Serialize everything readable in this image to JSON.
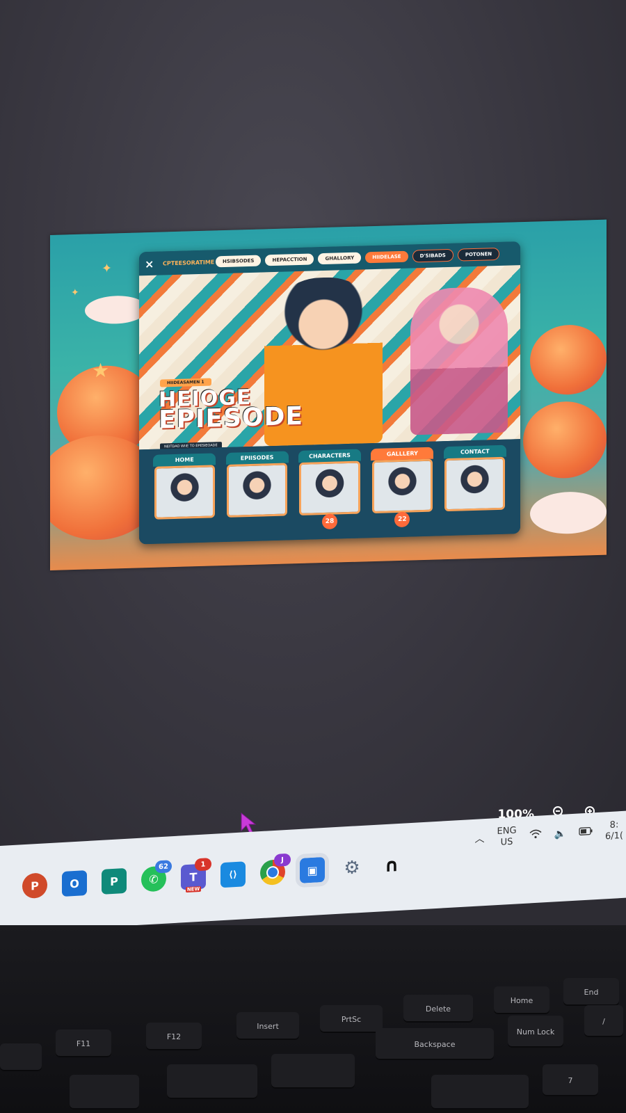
{
  "website": {
    "nav": {
      "close_icon": "×",
      "brand": "CPTEESORATIME",
      "items": [
        "HSIBSODES",
        "HEPACCTION",
        "GHALLORY"
      ],
      "right_items": [
        "HIIDELASE",
        "D'SIBADS",
        "POTONEN"
      ]
    },
    "hero": {
      "badge": "HIIDEASAMEN 1",
      "title_line1": "HEIOGE",
      "title_line2": "EPIESODE",
      "subtitle": "NEITDAO WIIE TO EPESIEOADE"
    },
    "cards": [
      {
        "label": "HOME",
        "badge": ""
      },
      {
        "label": "EPIISODES",
        "badge": ""
      },
      {
        "label": "CHARACTERS",
        "badge": "28"
      },
      {
        "label": "GALLLERY",
        "badge": "22"
      },
      {
        "label": "CONTACT",
        "badge": ""
      }
    ]
  },
  "viewer": {
    "zoom_level": "100%",
    "zoom_out_icon": "zoom-out-icon",
    "zoom_in_icon": "zoom-in-icon"
  },
  "taskbar": {
    "apps": [
      {
        "name": "powerpoint",
        "glyph": "P",
        "color": "#d04a2a",
        "badge": ""
      },
      {
        "name": "outlook",
        "glyph": "O",
        "color": "#1a6ed0",
        "badge": ""
      },
      {
        "name": "publisher",
        "glyph": "P",
        "color": "#0f8a7a",
        "badge": ""
      },
      {
        "name": "whatsapp",
        "glyph": "✆",
        "color": "#25c05a",
        "badge": "62"
      },
      {
        "name": "teams",
        "glyph": "T",
        "color": "#5a5ad0",
        "badge": "1"
      },
      {
        "name": "vscode",
        "glyph": "⟨⟩",
        "color": "#1a8ae0",
        "badge": ""
      },
      {
        "name": "chrome",
        "glyph": "●",
        "color": "#e0442a",
        "badge": "J"
      },
      {
        "name": "photos",
        "glyph": "▣",
        "color": "#2a7ae0",
        "badge": ""
      },
      {
        "name": "settings",
        "glyph": "⚙",
        "color": "#6a7a90",
        "badge": ""
      },
      {
        "name": "app-n",
        "glyph": "∩",
        "color": "#222",
        "badge": ""
      }
    ],
    "teams_sub": "NEW",
    "tray": {
      "lang_line1": "ENG",
      "lang_line2": "US",
      "time": "8:",
      "date": "6/1("
    }
  },
  "keyboard": {
    "keys": [
      "F11",
      "F12",
      "Insert",
      "PrtSc",
      "Delete",
      "Home",
      "End",
      "Backspace",
      "Num Lock",
      "7",
      "Home",
      "/"
    ]
  }
}
